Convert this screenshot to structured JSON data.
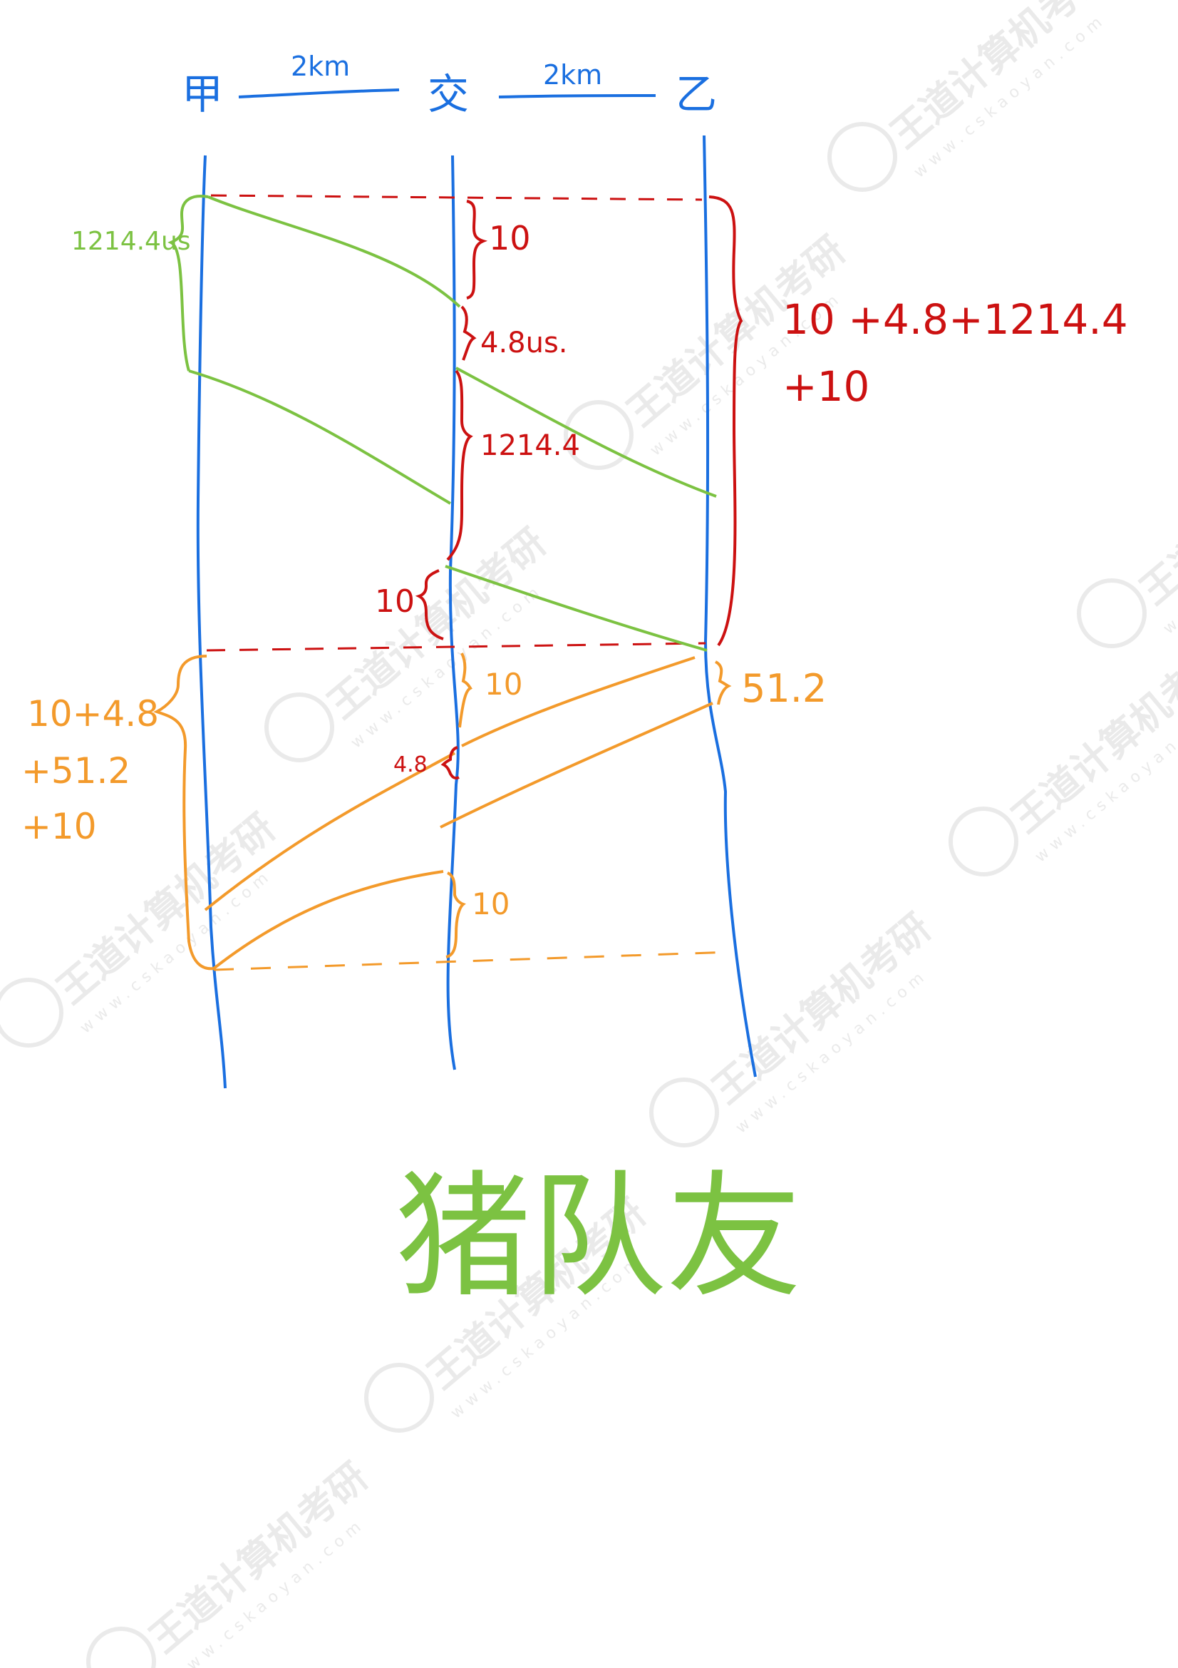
{
  "colors": {
    "timeline": "#1a6fe0",
    "frame": "#7cc242",
    "ack": "#f39a2b",
    "interval": "#cc1111",
    "watermark": "#d9d9d9"
  },
  "header": {
    "node_a": "甲",
    "node_switch": "交",
    "node_b": "乙",
    "dist_left": "2km",
    "dist_right": "2km"
  },
  "annotations": {
    "frame_tx_time": "1214.4us",
    "switch_delay_1": "10",
    "propagation_1": "4.8us.",
    "switch_tx_time": "1214.4",
    "propagation_2": "10",
    "total_frame_line1": "10 +4.8+1214.4",
    "total_frame_line2": "+10",
    "ack_switch_delay": "10",
    "ack_tx_time": "51.2",
    "ack_prop": "4.8",
    "ack_final_delay": "10",
    "ack_total_line1": "10+4.8",
    "ack_total_line2": "+51.2",
    "ack_total_line3": "+10"
  },
  "caption": "猪队友",
  "watermark": {
    "brand": "王道计算机考研",
    "url": "www.cskaoyan.com"
  }
}
